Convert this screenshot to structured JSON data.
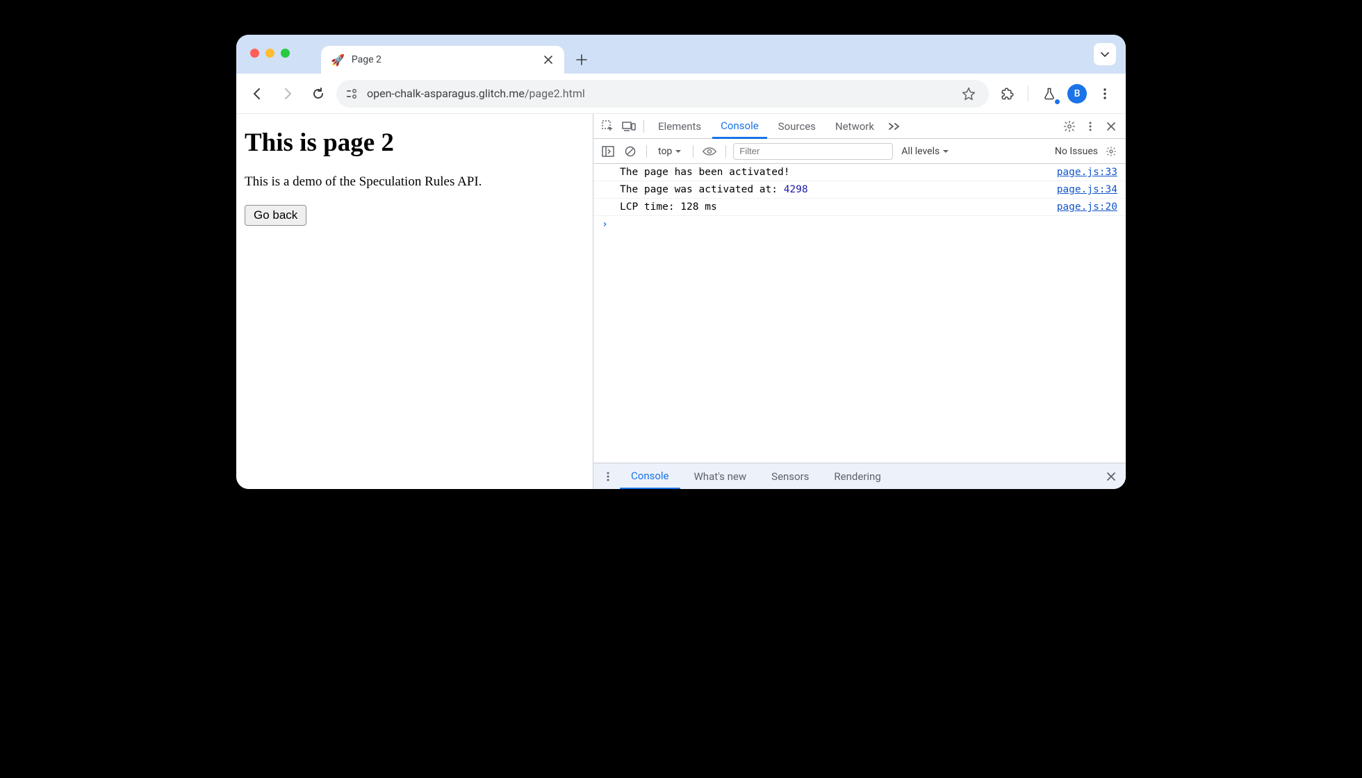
{
  "tab": {
    "favicon": "🚀",
    "title": "Page 2"
  },
  "url": {
    "host": "open-chalk-asparagus.glitch.me",
    "path": "/page2.html"
  },
  "profile_initial": "B",
  "page": {
    "heading": "This is page 2",
    "desc": "This is a demo of the Speculation Rules API.",
    "go_back": "Go back"
  },
  "devtools": {
    "tabs": {
      "elements": "Elements",
      "console": "Console",
      "sources": "Sources",
      "network": "Network"
    },
    "toolbar": {
      "context": "top",
      "filter_placeholder": "Filter",
      "levels": "All levels",
      "issues": "No Issues"
    },
    "logs": [
      {
        "msg_pre": "The page has been activated!",
        "msg_num": "",
        "msg_post": "",
        "src": "page.js:33"
      },
      {
        "msg_pre": "The page was activated at: ",
        "msg_num": "4298",
        "msg_post": "",
        "src": "page.js:34"
      },
      {
        "msg_pre": "LCP time: 128 ms",
        "msg_num": "",
        "msg_post": "",
        "src": "page.js:20"
      }
    ],
    "prompt": "›",
    "drawer": {
      "console": "Console",
      "whatsnew": "What's new",
      "sensors": "Sensors",
      "rendering": "Rendering"
    }
  }
}
